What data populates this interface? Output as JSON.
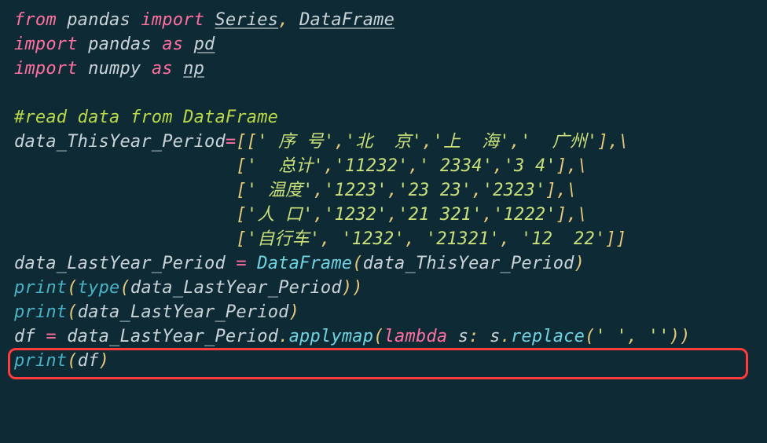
{
  "code": {
    "line1": {
      "kw_from": "from",
      "mod": "pandas",
      "kw_import": "import",
      "sym1": "Series",
      "comma": ",",
      "sym2": "DataFrame"
    },
    "line2": {
      "kw_import": "import",
      "mod": "pandas",
      "kw_as": "as",
      "alias": "pd"
    },
    "line3": {
      "kw_import": "import",
      "mod": "numpy",
      "kw_as": "as",
      "alias": "np"
    },
    "line5": {
      "comment": "#read data from DataFrame"
    },
    "line6": {
      "var": "data_ThisYear_Period",
      "eq": "=",
      "lb": "[[",
      "s1": "' 序 号'",
      "c": ",",
      "s2": "'北  京'",
      "s3": "'上  海'",
      "s4": "'  广州'",
      "rb": "]",
      "cont": ",\\"
    },
    "line7": {
      "pad": "                     ",
      "lb": "[",
      "s1": "'  总计'",
      "c": ",",
      "s2": "'11232'",
      "s3": "' 2334'",
      "s4": "'3 4'",
      "rb": "]",
      "cont": ",\\"
    },
    "line8": {
      "pad": "                     ",
      "lb": "[",
      "s1": "' 温度'",
      "c": ",",
      "s2": "'1223'",
      "s3": "'23 23'",
      "s4": "'2323'",
      "rb": "]",
      "cont": ",\\"
    },
    "line9": {
      "pad": "                     ",
      "lb": "[",
      "s1": "'人 口'",
      "c": ",",
      "s2": "'1232'",
      "s3": "'21 321'",
      "s4": "'1222'",
      "rb": "]",
      "cont": ",\\"
    },
    "line10": {
      "pad": "                     ",
      "lb": "[",
      "s1": "'自行车'",
      "c": ",",
      "sp": " ",
      "s2": "'1232'",
      "s3": "'21321'",
      "s4": "'12  22'",
      "rb": "]]"
    },
    "line11": {
      "var": "data_LastYear_Period",
      "eq": " = ",
      "fn": "DataFrame",
      "lp": "(",
      "arg": "data_ThisYear_Period",
      "rp": ")"
    },
    "line12": {
      "bi": "print",
      "lp": "(",
      "bi2": "type",
      "lp2": "(",
      "arg": "data_LastYear_Period",
      "rp2": ")",
      "rp": ")"
    },
    "line13": {
      "bi": "print",
      "lp": "(",
      "arg": "data_LastYear_Period",
      "rp": ")"
    },
    "line14": {
      "var": "df",
      "eq": " = ",
      "obj": "data_LastYear_Period",
      "dot": ".",
      "meth": "applymap",
      "lp": "(",
      "kw_lambda": "lambda",
      "param": " s",
      "colon": ":",
      "body_obj": " s",
      "dot2": ".",
      "meth2": "replace",
      "lp2": "(",
      "s1": "' '",
      "c": ",",
      "sp": " ",
      "s2": "''",
      "rp2": ")",
      "rp": ")"
    },
    "line15": {
      "bi": "print",
      "lp": "(",
      "arg": "df",
      "rp": ")"
    }
  },
  "highlight": {
    "description": "highlighted line box"
  }
}
